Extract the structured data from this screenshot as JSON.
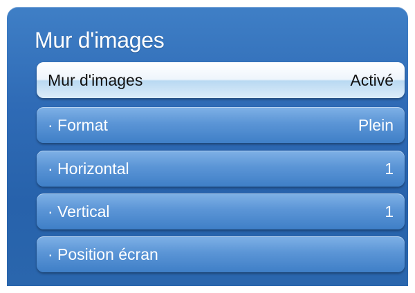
{
  "menu": {
    "title": "Mur d'images",
    "items": [
      {
        "label": "Mur d'images",
        "value": "Activé",
        "selected": true
      },
      {
        "label": "· Format",
        "value": "Plein"
      },
      {
        "label": "· Horizontal",
        "value": "1"
      },
      {
        "label": "· Vertical",
        "value": "1"
      },
      {
        "label": "· Position écran",
        "value": ""
      }
    ]
  },
  "colors": {
    "panel": "#2f6bb6",
    "item": "#5b95d6",
    "selected_item": "#eef5fc",
    "text": "#ffffff",
    "selected_text": "#111111"
  }
}
